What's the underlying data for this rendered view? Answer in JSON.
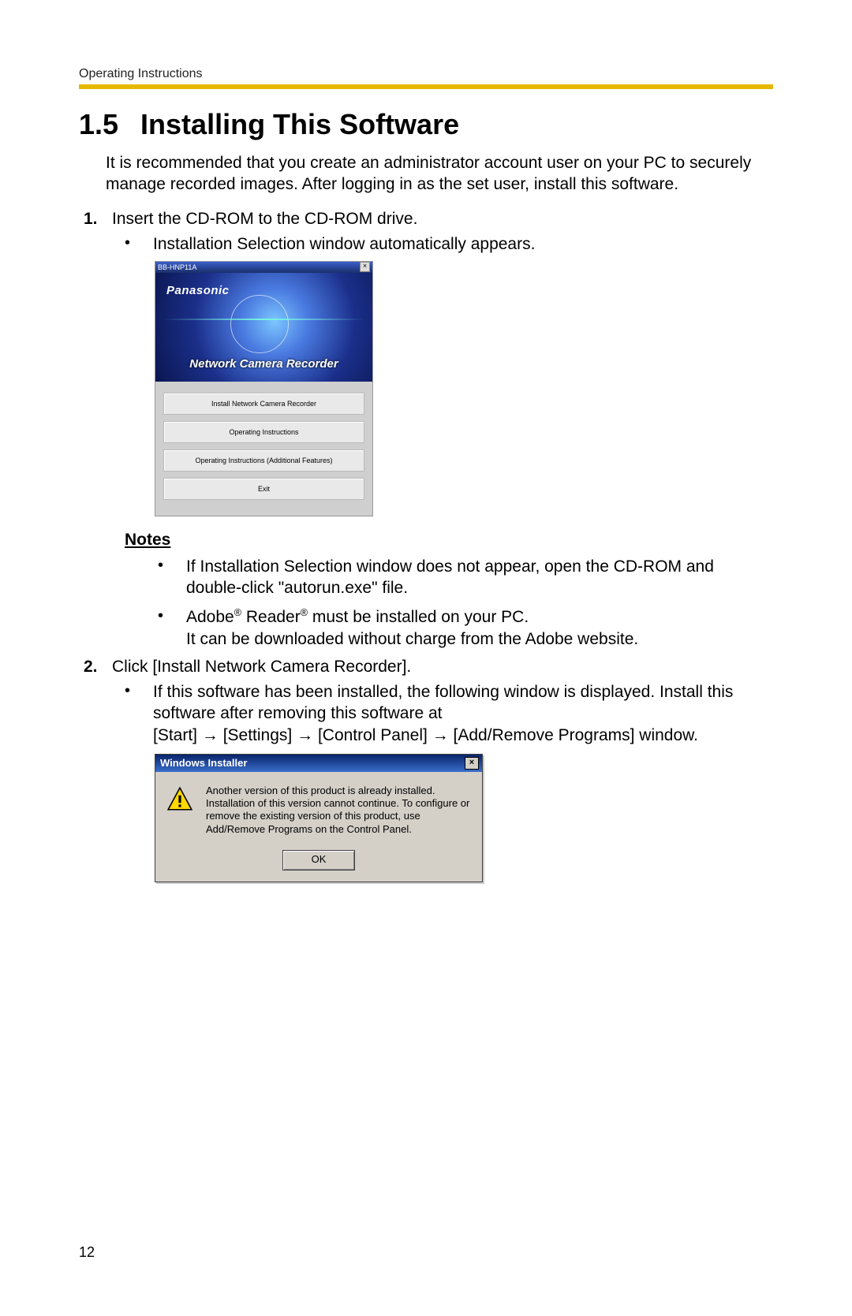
{
  "header_label": "Operating Instructions",
  "section_number": "1.5",
  "section_title": "Installing This Software",
  "intro": "It is recommended that you create an administrator account user on your PC to securely manage recorded images. After logging in as the set user, install this software.",
  "step1": {
    "num": "1.",
    "text": "Insert the CD-ROM to the CD-ROM drive.",
    "bullet": "Installation Selection window automatically appears."
  },
  "splash": {
    "titlebar": "BB-HNP11A",
    "brand": "Panasonic",
    "product": "Network Camera Recorder",
    "buttons": [
      "Install Network Camera Recorder",
      "Operating Instructions",
      "Operating Instructions (Additional Features)",
      "Exit"
    ]
  },
  "notes_heading": "Notes",
  "notes": {
    "n1": "If Installation Selection window does not appear, open the CD-ROM and double-click \"autorun.exe\" file.",
    "n2a": "Adobe",
    "n2b": " Reader",
    "n2c": " must be installed on your PC.",
    "n2d": "It can be downloaded  without charge from the Adobe website."
  },
  "step2": {
    "num": "2.",
    "text": "Click [Install Network Camera Recorder].",
    "bullet_a": "If this software has been installed, the following window is displayed. Install this software after removing this software at",
    "path": [
      "[Start]",
      "[Settings]",
      "[Control Panel]",
      "[Add/Remove Programs] window."
    ]
  },
  "windlg": {
    "title": "Windows Installer",
    "message": "Another version of this product is already installed. Installation of this version cannot continue.  To configure or remove the existing version of this product, use Add/Remove Programs on the Control Panel.",
    "ok": "OK"
  },
  "page_number": "12",
  "reg_mark": "®"
}
